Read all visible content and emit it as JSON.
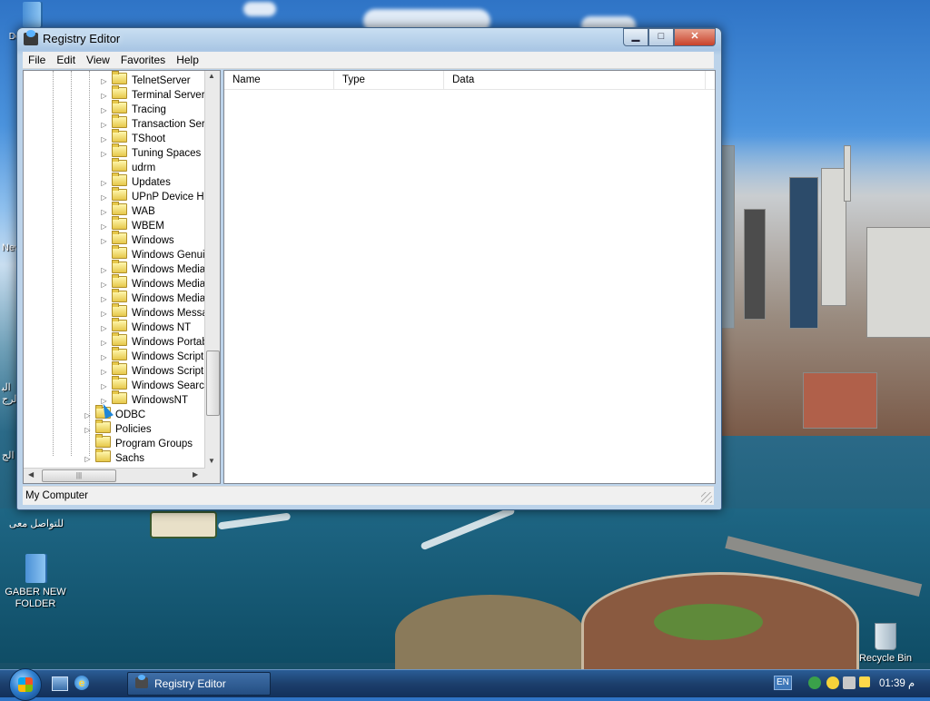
{
  "desktop": {
    "icons": [
      {
        "label": "Documents"
      },
      {
        "label": "للتواصل معى"
      },
      {
        "label": "GABER NEW FOLDER"
      },
      {
        "label": "Recycle Bin"
      }
    ],
    "edge_labels": [
      "New",
      "ﺍﻟﺒ",
      "ﺍﻟﺮﺝ",
      "ﺍﻟﺞ"
    ]
  },
  "window": {
    "title": "Registry Editor",
    "caption_buttons": {
      "minimize": "▁",
      "maximize": "□",
      "close": "✕"
    },
    "menu": [
      "File",
      "Edit",
      "View",
      "Favorites",
      "Help"
    ],
    "tree": {
      "items": [
        {
          "label": "TelnetServer",
          "expander": "▷",
          "level": 2
        },
        {
          "label": "Terminal Server",
          "expander": "▷",
          "level": 2
        },
        {
          "label": "Tracing",
          "expander": "▷",
          "level": 2
        },
        {
          "label": "Transaction Serv",
          "expander": "▷",
          "level": 2
        },
        {
          "label": "TShoot",
          "expander": "▷",
          "level": 2
        },
        {
          "label": "Tuning Spaces",
          "expander": "▷",
          "level": 2
        },
        {
          "label": "udrm",
          "expander": "",
          "level": 2
        },
        {
          "label": "Updates",
          "expander": "▷",
          "level": 2
        },
        {
          "label": "UPnP Device Hos",
          "expander": "▷",
          "level": 2
        },
        {
          "label": "WAB",
          "expander": "▷",
          "level": 2
        },
        {
          "label": "WBEM",
          "expander": "▷",
          "level": 2
        },
        {
          "label": "Windows",
          "expander": "▷",
          "level": 2
        },
        {
          "label": "Windows Genuin",
          "expander": "",
          "level": 2
        },
        {
          "label": "Windows Media",
          "expander": "▷",
          "level": 2
        },
        {
          "label": "Windows Media",
          "expander": "▷",
          "level": 2
        },
        {
          "label": "Windows Media",
          "expander": "▷",
          "level": 2
        },
        {
          "label": "Windows Messa",
          "expander": "▷",
          "level": 2
        },
        {
          "label": "Windows NT",
          "expander": "▷",
          "level": 2
        },
        {
          "label": "Windows Portab",
          "expander": "▷",
          "level": 2
        },
        {
          "label": "Windows Script I",
          "expander": "▷",
          "level": 2
        },
        {
          "label": "Windows Scriptin",
          "expander": "▷",
          "level": 2
        },
        {
          "label": "Windows Search",
          "expander": "▷",
          "level": 2
        },
        {
          "label": "WindowsNT",
          "expander": "▷",
          "level": 2
        },
        {
          "label": "ODBC",
          "expander": "▷",
          "level": 1
        },
        {
          "label": "Policies",
          "expander": "▷",
          "level": 1
        },
        {
          "label": "Program Groups",
          "expander": "",
          "level": 1
        },
        {
          "label": "Sachs",
          "expander": "▷",
          "level": 1
        }
      ]
    },
    "list": {
      "columns": [
        "Name",
        "Type",
        "Data"
      ]
    },
    "status": "My Computer"
  },
  "taskbar": {
    "task_label": "Registry Editor",
    "language": "EN",
    "clock": "01:39 م"
  },
  "colors": {
    "titlebar": "#bcd3ea",
    "taskbar": "#1c3f6c",
    "close_button": "#c8412a"
  }
}
